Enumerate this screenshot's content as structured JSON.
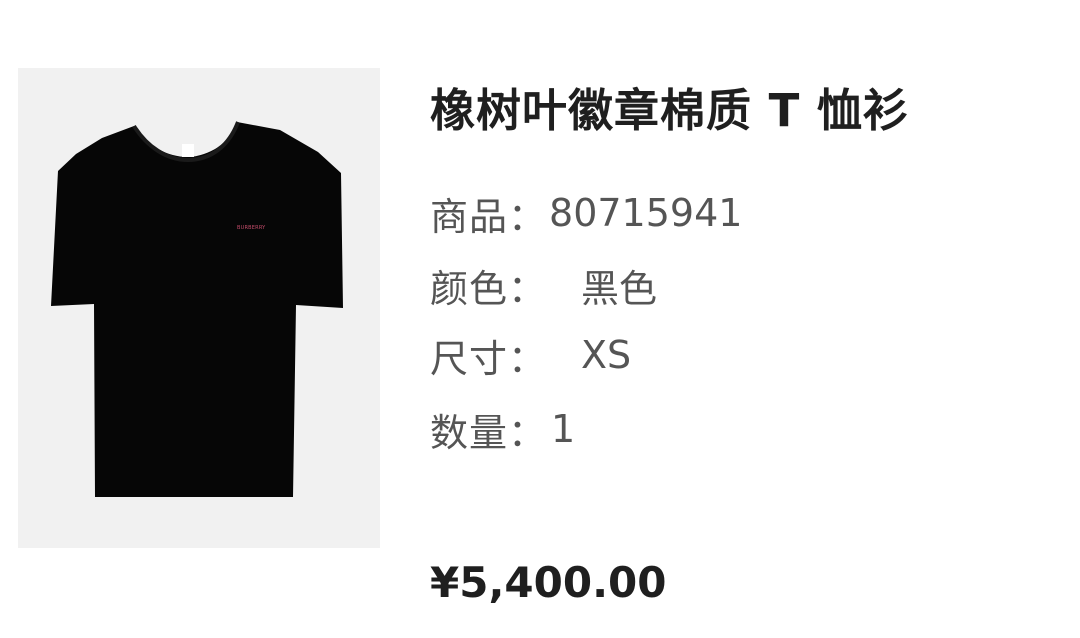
{
  "product": {
    "image": {
      "brand_mark": "BURBERRY",
      "image_description": "black-tshirt-icon"
    },
    "title": "橡树叶徽章棉质 T 恤衫",
    "specs": [
      {
        "label": "商品：",
        "value": "80715941"
      },
      {
        "label": "颜色：",
        "value": "黑色"
      },
      {
        "label": "尺寸：",
        "value": "XS"
      },
      {
        "label": "数量：",
        "value": "1"
      }
    ],
    "price": "¥5,400.00"
  },
  "colors": {
    "background": "#ffffff",
    "image_background": "#f1f1f1",
    "garment": "#060606",
    "brand_mark": "#c44c6a",
    "label_text": "#555555",
    "title_text": "#1f1f1f"
  }
}
